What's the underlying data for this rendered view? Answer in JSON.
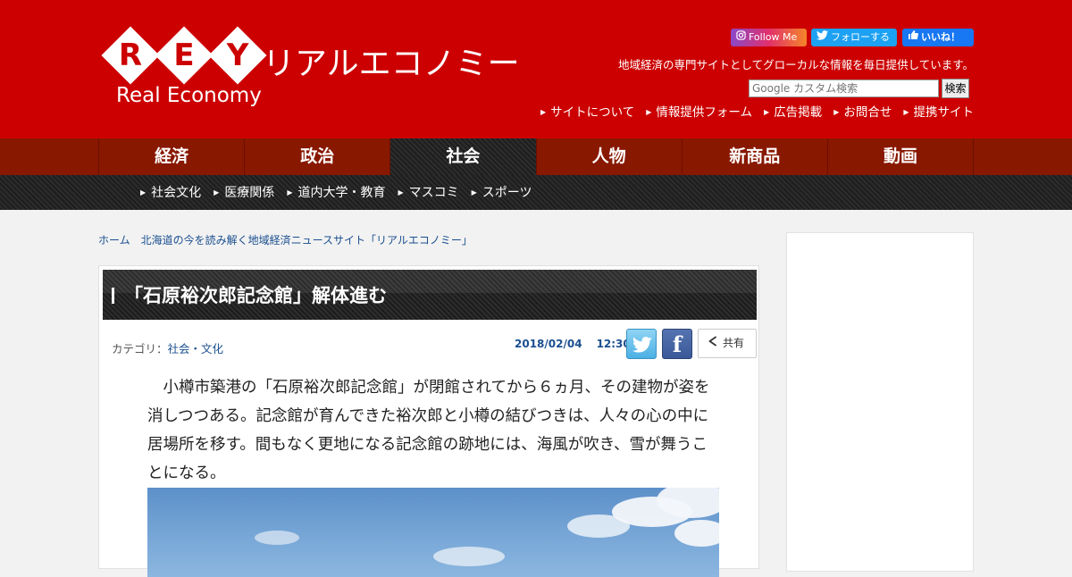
{
  "brand": {
    "logo_letters": [
      "R",
      "E",
      "Y"
    ],
    "logo_jp": "リアルエコノミー",
    "logo_en": "Real Economy",
    "colors": {
      "header_bg": "#cc0000",
      "nav_bg": "#881800",
      "link": "#1a4f8f"
    }
  },
  "social": {
    "instagram": {
      "label": "Follow Me",
      "icon": "instagram-icon"
    },
    "twitter": {
      "label": "フォローする",
      "icon": "twitter-icon"
    },
    "facebook": {
      "label": "いいね！",
      "icon": "facebook-like-icon"
    }
  },
  "tagline": "地域経済の専門サイトとしてグローカルな情報を毎日提供しています。",
  "search": {
    "placeholder": "Google カスタム検索",
    "button": "検索"
  },
  "util_links": [
    "サイトについて",
    "情報提供フォーム",
    "広告掲載",
    "お問合せ",
    "提携サイト"
  ],
  "main_nav": [
    {
      "label": "経済",
      "active": false
    },
    {
      "label": "政治",
      "active": false
    },
    {
      "label": "社会",
      "active": true
    },
    {
      "label": "人物",
      "active": false
    },
    {
      "label": "新商品",
      "active": false
    },
    {
      "label": "動画",
      "active": false
    }
  ],
  "sub_nav": [
    "社会文化",
    "医療関係",
    "道内大学・教育",
    "マスコミ",
    "スポーツ"
  ],
  "breadcrumb": {
    "home": "ホーム",
    "current": "北海道の今を読み解く地域経済ニュースサイト「リアルエコノミー」"
  },
  "article": {
    "title": "「石原裕次郎記念館」解体進む",
    "category_label": "カテゴリ：",
    "category": "社会・文化",
    "date": "2018/02/04",
    "time": "12:30",
    "share_label": "共有",
    "body": "小樽市築港の「石原裕次郎記念館」が閉館されてから６ヵ月、その建物が姿を消しつつある。記念館が育んできた裕次郎と小樽の結びつきは、人々の心の中に居場所を移す。間もなく更地になる記念館の跡地には、海風が吹き、雪が舞うことになる。"
  }
}
